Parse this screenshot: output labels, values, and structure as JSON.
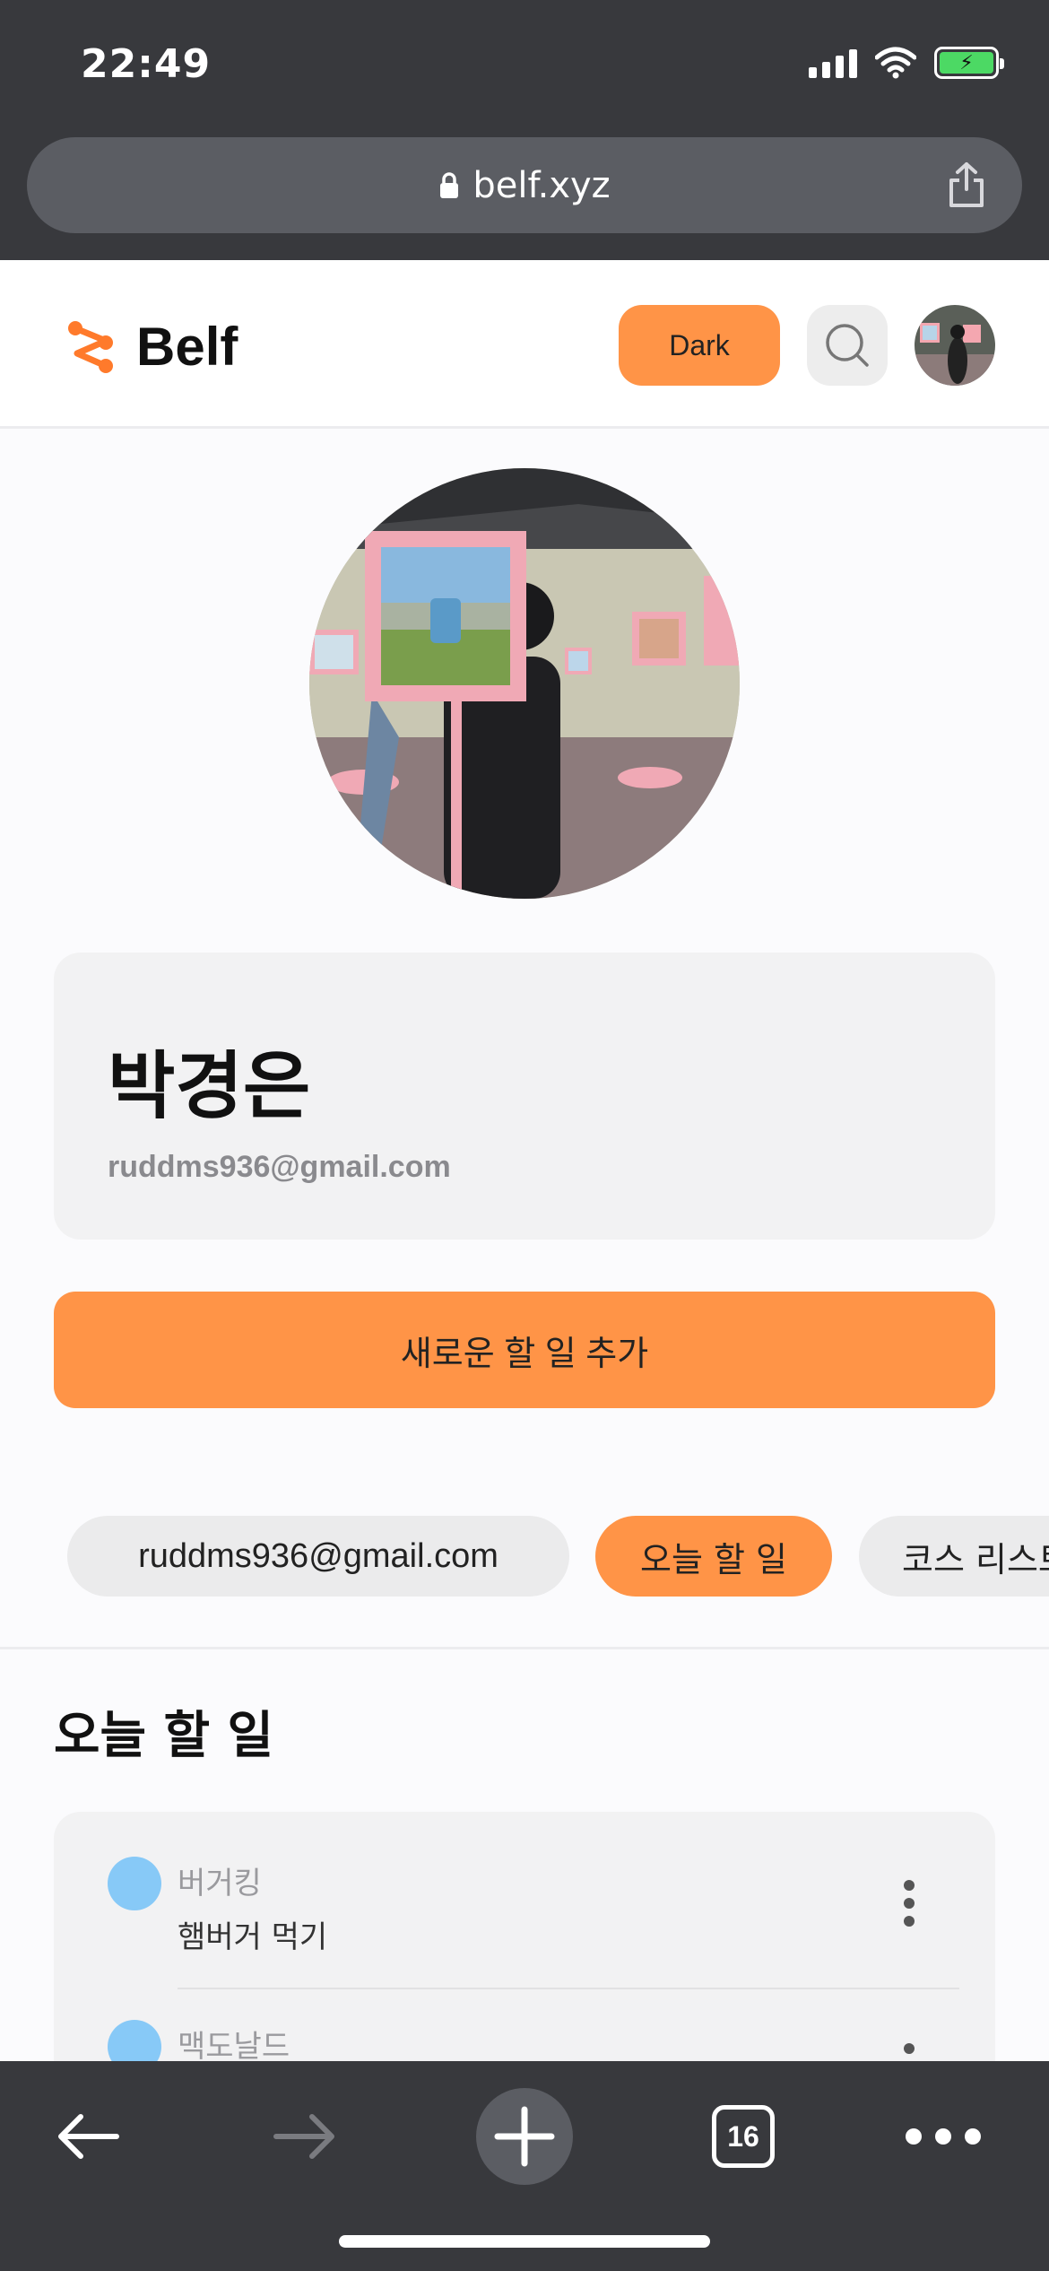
{
  "status_bar": {
    "time": "22:49"
  },
  "browser": {
    "url": "belf.xyz",
    "tab_count": "16"
  },
  "header": {
    "logo_text": "Belf",
    "dark_button_label": "Dark"
  },
  "profile": {
    "name": "박경은",
    "email": "ruddms936@gmail.com"
  },
  "add_button_label": "새로운 할 일 추가",
  "chips": [
    {
      "label": "ruddms936@gmail.com"
    },
    {
      "label": "오늘 할 일"
    },
    {
      "label": "코스 리스트"
    }
  ],
  "section_title": "오늘 할 일",
  "todos": [
    {
      "title": "버거킹",
      "desc": "햄버거 먹기"
    },
    {
      "title": "맥도날드",
      "desc": ""
    }
  ],
  "colors": {
    "accent": "#ff9447",
    "todo_dot": "#87c9f7",
    "chrome": "#38393d"
  }
}
